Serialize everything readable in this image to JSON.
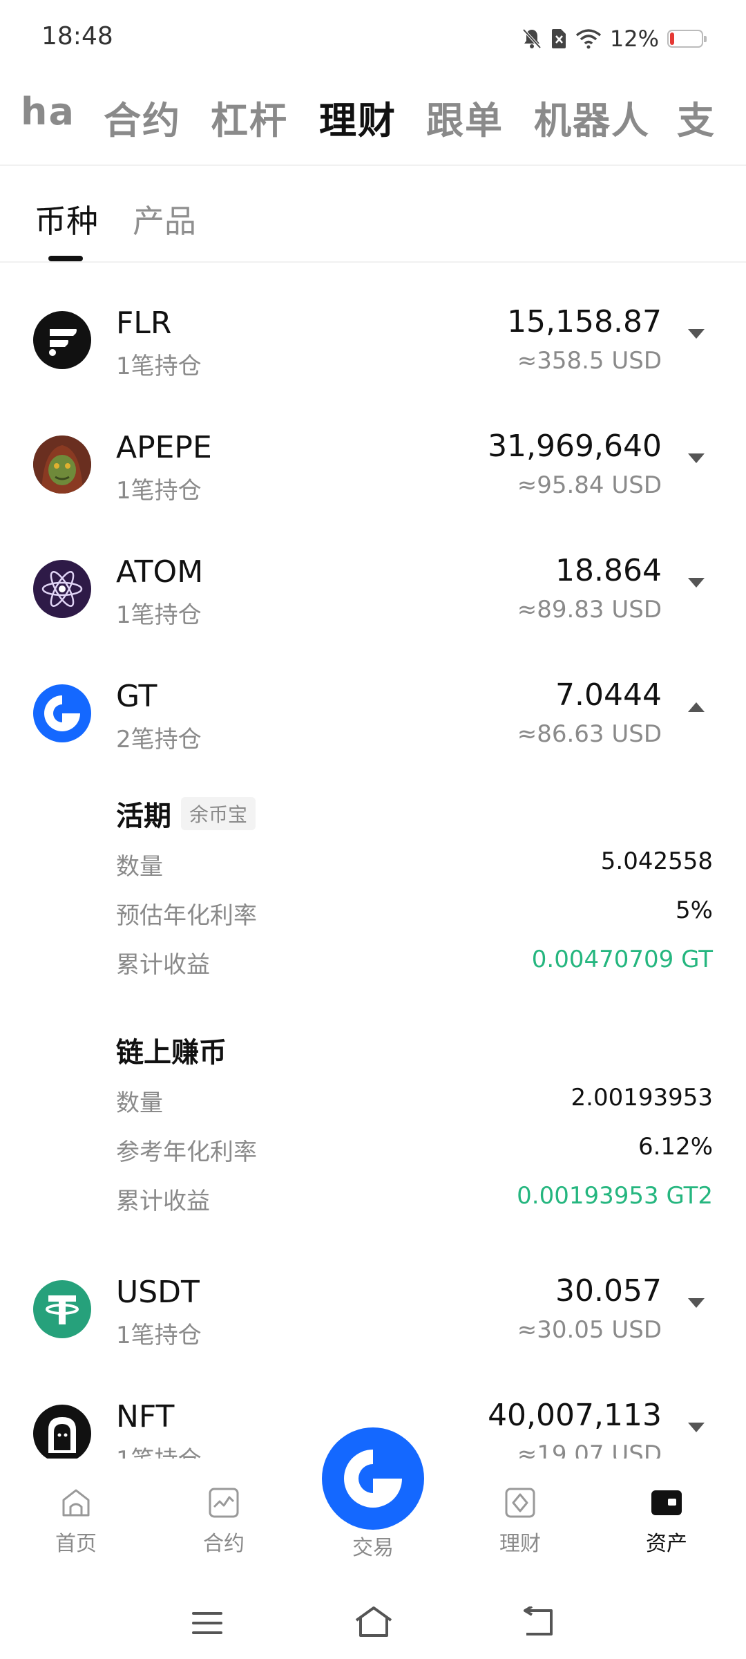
{
  "status_bar": {
    "time": "18:48",
    "battery": "12%",
    "icons": [
      "bell-off-icon",
      "sim-off-icon",
      "wifi-icon",
      "battery-icon"
    ]
  },
  "top_tabs": [
    {
      "label": "ha",
      "active": false
    },
    {
      "label": "合约",
      "active": false
    },
    {
      "label": "杠杆",
      "active": false
    },
    {
      "label": "理财",
      "active": true
    },
    {
      "label": "跟单",
      "active": false
    },
    {
      "label": "机器人",
      "active": false
    },
    {
      "label": "支",
      "active": false
    }
  ],
  "sub_tabs": [
    {
      "label": "币种",
      "active": true
    },
    {
      "label": "产品",
      "active": false
    }
  ],
  "assets": [
    {
      "name": "FLR",
      "positions": "1笔持仓",
      "amount": "15,158.87",
      "usd": "≈358.5 USD",
      "expanded": false,
      "logo": "flare-logo"
    },
    {
      "name": "APEPE",
      "positions": "1笔持仓",
      "amount": "31,969,640",
      "usd": "≈95.84 USD",
      "expanded": false,
      "logo": "apepe-logo"
    },
    {
      "name": "ATOM",
      "positions": "1笔持仓",
      "amount": "18.864",
      "usd": "≈89.83 USD",
      "expanded": false,
      "logo": "cosmos-logo"
    },
    {
      "name": "GT",
      "positions": "2笔持仓",
      "amount": "7.0444",
      "usd": "≈86.63 USD",
      "expanded": true,
      "logo": "gate-logo"
    },
    {
      "name": "USDT",
      "positions": "1笔持仓",
      "amount": "30.057",
      "usd": "≈30.05 USD",
      "expanded": false,
      "logo": "tether-logo"
    },
    {
      "name": "NFT",
      "positions": "1笔持仓",
      "amount": "40,007,113",
      "usd": "≈19.07 USD",
      "expanded": false,
      "logo": "apenft-logo"
    }
  ],
  "gt_details": [
    {
      "title": "活期",
      "badge": "余币宝",
      "rows": [
        {
          "label": "数量",
          "value": "5.042558"
        },
        {
          "label": "预估年化利率",
          "value": "5%"
        },
        {
          "label": "累计收益",
          "value": "0.00470709 GT"
        }
      ]
    },
    {
      "title": "链上赚币",
      "badge": "",
      "rows": [
        {
          "label": "数量",
          "value": "2.00193953"
        },
        {
          "label": "参考年化利率",
          "value": "6.12%"
        },
        {
          "label": "累计收益",
          "value": "0.00193953 GT2"
        }
      ]
    }
  ],
  "bottom_nav": [
    {
      "label": "首页",
      "icon": "home-icon",
      "active": false
    },
    {
      "label": "合约",
      "icon": "futures-chart-icon",
      "active": false
    },
    {
      "label": "交易",
      "icon": "gate-trade-icon",
      "active": false
    },
    {
      "label": "理财",
      "icon": "earn-icon",
      "active": false
    },
    {
      "label": "资产",
      "icon": "wallet-icon",
      "active": true
    }
  ],
  "colors": {
    "accent_blue": "#1468ff",
    "profit_green": "#25b67f",
    "muted_text": "#8a8a8a"
  }
}
